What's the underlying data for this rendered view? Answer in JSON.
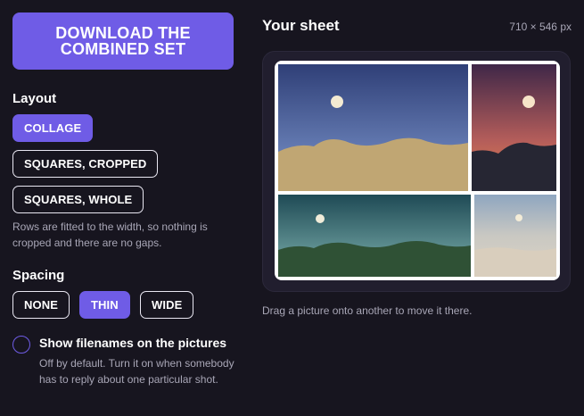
{
  "download": {
    "label": "DOWNLOAD THE COMBINED SET"
  },
  "layout": {
    "title": "Layout",
    "options": [
      "COLLAGE",
      "SQUARES, CROPPED",
      "SQUARES, WHOLE"
    ],
    "selected": "COLLAGE",
    "help": "Rows are fitted to the width, so nothing is cropped and there are no gaps."
  },
  "spacing": {
    "title": "Spacing",
    "options": [
      "NONE",
      "THIN",
      "WIDE"
    ],
    "selected": "THIN"
  },
  "filenames": {
    "label": "Show filenames on the pictures",
    "checked": false,
    "help": "Off by default. Turn it on when somebody has to reply about one particular shot."
  },
  "sheet": {
    "title": "Your sheet",
    "size": "710 × 546 px",
    "caption": "Drag a picture onto another to move it there."
  },
  "colors": {
    "accent": "#6f5ce6",
    "background": "#17151f",
    "panel": "#211e2e",
    "muted_text": "#a8a6b6"
  }
}
